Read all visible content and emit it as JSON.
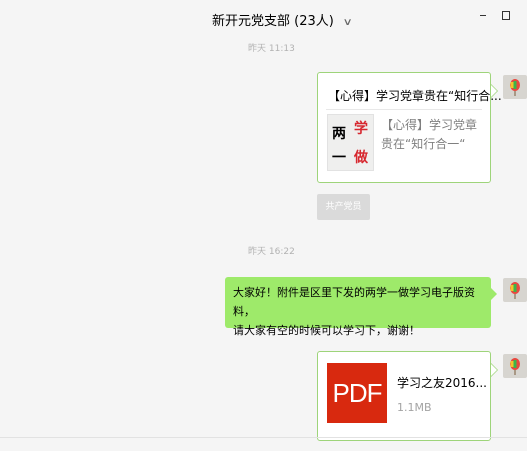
{
  "window": {
    "title": "新开元党支部",
    "member_count": "(23人)",
    "icons": [
      "chevron-down-icon",
      "minimize-icon",
      "maximize-icon"
    ]
  },
  "messages": {
    "timestamp_1": "昨天 11:13",
    "link_card": {
      "title": "【心得】学习党章贵在“知行合...",
      "description": "【心得】学习党章贵在“知行合一“",
      "thumbnail_chars": [
        "两",
        "学",
        "一",
        "做"
      ]
    },
    "sender_tag": "共产党员",
    "timestamp_2": "昨天 16:22",
    "text_message": {
      "line1": "大家好！附件是区里下发的两学一做学习电子版资料，",
      "line2": "请大家有空的时候可以学习下，谢谢！"
    },
    "file_card": {
      "icon_label": "PDF",
      "file_name": "学习之友2016...",
      "file_size": "1.1MB"
    }
  },
  "colors": {
    "bubble_green": "#9eea6a",
    "card_border": "#9ed47a",
    "pdf_red": "#d8290f",
    "background": "#f5f5f5"
  }
}
